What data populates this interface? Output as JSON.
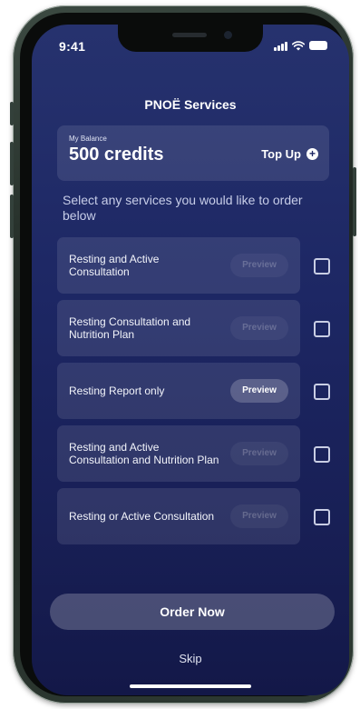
{
  "status_bar": {
    "time": "9:41",
    "icons": [
      "signal-icon",
      "wifi-icon",
      "battery-icon"
    ]
  },
  "header": {
    "title": "PNOË Services"
  },
  "balance": {
    "label": "My Balance",
    "value": "500 credits",
    "topup_label": "Top Up",
    "topup_icon": "plus-circle-icon"
  },
  "instruction": "Select any services you would like to order below",
  "services": [
    {
      "name": "Resting and Active Consultation",
      "preview_label": "Preview",
      "preview_enabled": false,
      "checked": false
    },
    {
      "name": "Resting Consultation and Nutrition Plan",
      "preview_label": "Preview",
      "preview_enabled": false,
      "checked": false
    },
    {
      "name": "Resting Report only",
      "preview_label": "Preview",
      "preview_enabled": true,
      "checked": false
    },
    {
      "name": "Resting and Active Consultation and Nutrition Plan",
      "preview_label": "Preview",
      "preview_enabled": false,
      "checked": false
    },
    {
      "name": "Resting or Active Consultation",
      "preview_label": "Preview",
      "preview_enabled": false,
      "checked": false
    }
  ],
  "actions": {
    "order_label": "Order Now",
    "skip_label": "Skip"
  },
  "colors": {
    "background_top": "#26326e",
    "background_bottom": "#131848",
    "phone_frame": "#2e3a33"
  }
}
